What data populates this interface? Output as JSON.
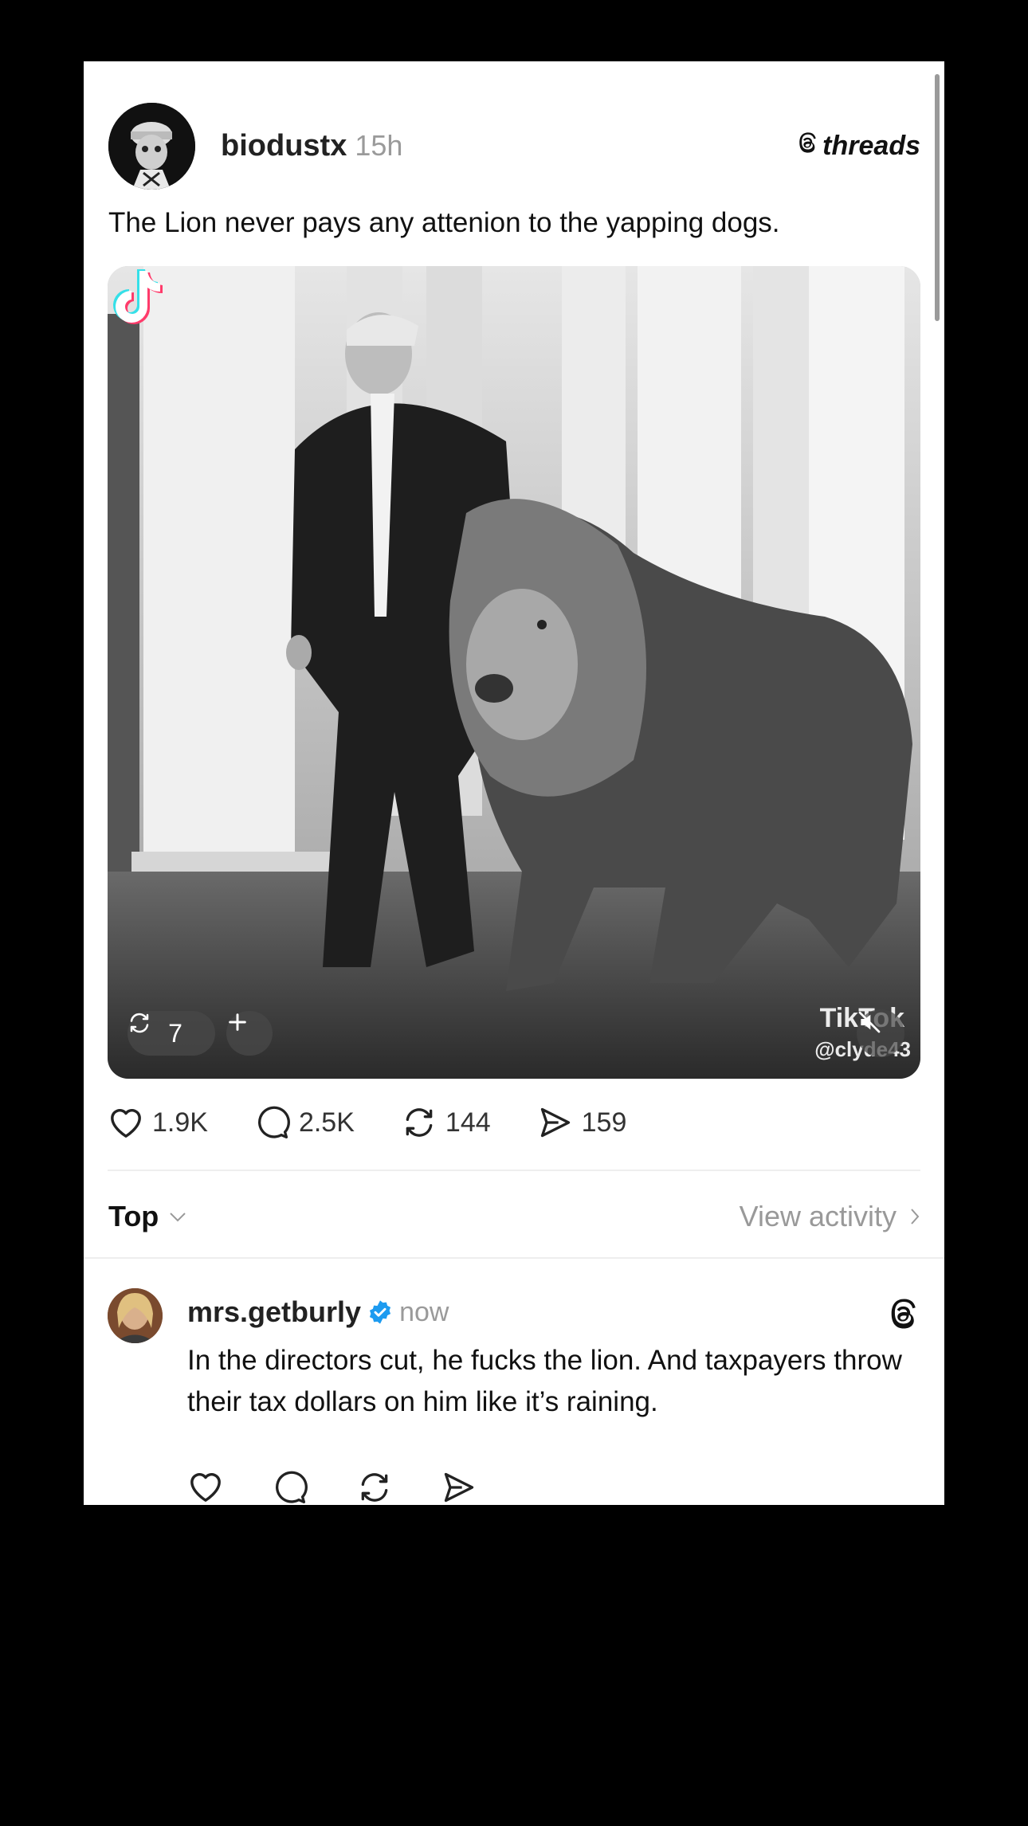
{
  "post": {
    "username": "biodustx",
    "time": "15h",
    "brand": "threads",
    "caption": "The Lion never pays any attenion to the yapping dogs.",
    "media": {
      "repost_count": "7",
      "watermark_brand": "TikTok",
      "watermark_handle": "@clyde43"
    },
    "stats": {
      "likes": "1.9K",
      "replies": "2.5K",
      "reposts": "144",
      "shares": "159"
    }
  },
  "sort": {
    "label": "Top",
    "view_activity": "View activity"
  },
  "reply": {
    "username": "mrs.getburly",
    "time": "now",
    "text": "In the directors cut, he fucks the lion. And taxpayers throw their tax dollars on him like it’s raining."
  },
  "icons": {
    "like": "heart-icon",
    "reply": "speech-bubble-icon",
    "repost": "repost-icon",
    "share": "send-icon",
    "verified": "verified-badge-icon",
    "threads": "threads-logo-icon"
  },
  "colors": {
    "background": "#000000",
    "card": "#ffffff",
    "verified": "#1d9bf0",
    "muted_text": "#9a9a9a"
  }
}
